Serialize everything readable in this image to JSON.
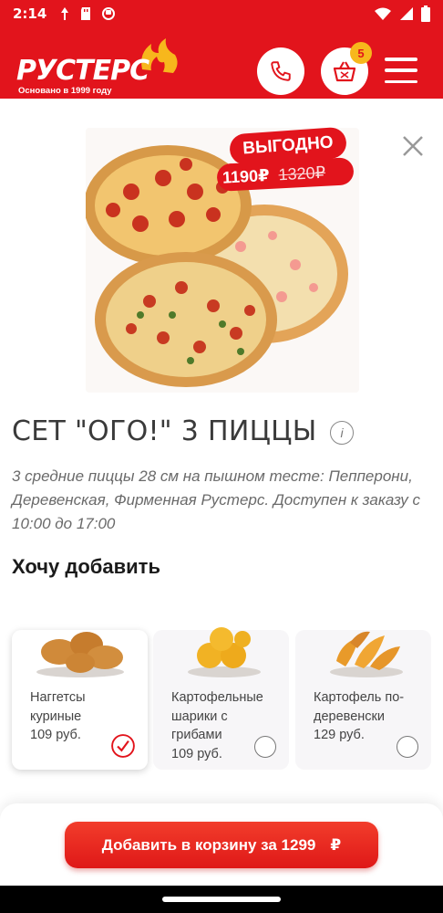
{
  "status_bar": {
    "time": "2:14"
  },
  "header": {
    "logo_text": "РУСТЕРС",
    "logo_tagline": "Основано в 1999 году",
    "cart_count": "5"
  },
  "product": {
    "promo_label": "ВЫГОДНО",
    "promo_price": "1190₽",
    "promo_old_price": "1320₽",
    "title": "СЕТ \"ОГО!\" 3 ПИЦЦЫ",
    "info_icon": "i",
    "description": "3 средние пиццы 28 см на пышном тесте: Пепперони, Деревенская, Фирменная Рустерс. Доступен к заказу с 10:00 до 17:00"
  },
  "addons": {
    "title": "Хочу добавить",
    "items": [
      {
        "name": "Наггетсы куриные",
        "price": "109 руб.",
        "selected": true
      },
      {
        "name": "Картофельные шарики с грибами",
        "price": "109 руб.",
        "selected": false
      },
      {
        "name": "Картофель по-деревенски",
        "price": "129 руб.",
        "selected": false
      }
    ]
  },
  "cart_button": {
    "label": "Добавить в корзину за 1299",
    "currency": "₽"
  },
  "colors": {
    "brand_red": "#e2141c",
    "badge_yellow": "#f7b71c"
  }
}
